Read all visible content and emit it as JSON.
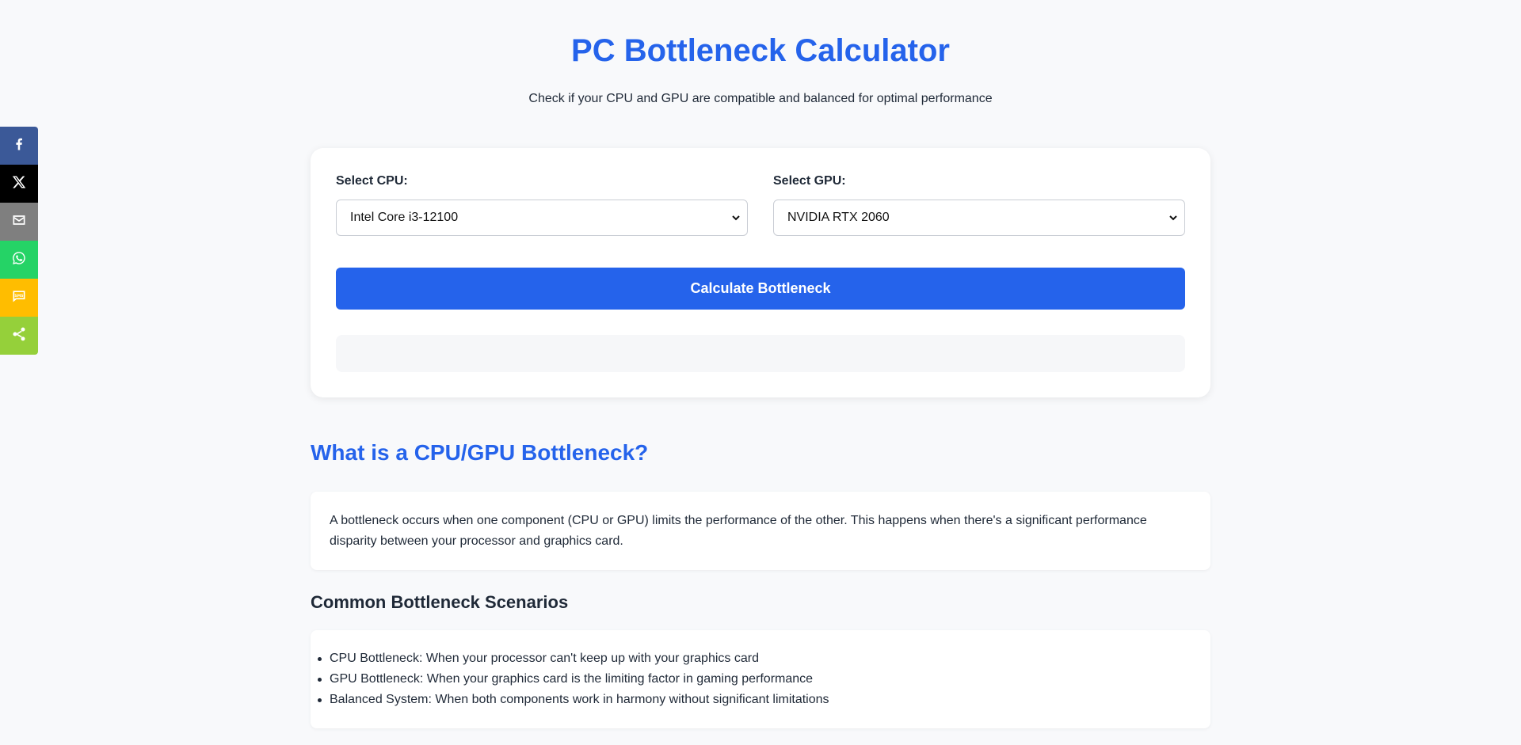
{
  "share": {
    "items": [
      {
        "name": "facebook",
        "color": "#3b5998",
        "icon": "facebook-icon"
      },
      {
        "name": "x",
        "color": "#000000",
        "icon": "x-icon"
      },
      {
        "name": "email",
        "color": "#7f7f7f",
        "icon": "email-icon"
      },
      {
        "name": "whatsapp",
        "color": "#25d366",
        "icon": "whatsapp-icon"
      },
      {
        "name": "sms",
        "color": "#ffbd00",
        "icon": "sms-icon"
      },
      {
        "name": "share",
        "color": "#95d03a",
        "icon": "share-icon"
      }
    ]
  },
  "header": {
    "title": "PC Bottleneck Calculator",
    "subtitle": "Check if your CPU and GPU are compatible and balanced for optimal performance"
  },
  "calculator": {
    "cpu_label": "Select CPU:",
    "cpu_value": "Intel Core i3-12100",
    "gpu_label": "Select GPU:",
    "gpu_value": "NVIDIA RTX 2060",
    "button_label": "Calculate Bottleneck",
    "accent_color": "#2563eb"
  },
  "content": {
    "section_title": "What is a CPU/GPU Bottleneck?",
    "section_text_line1": "A bottleneck occurs when one component (CPU or GPU) limits the performance of the other. This happens when there's a significant performance",
    "section_text_line2": "disparity between your processor and graphics card.",
    "scenarios_title": "Common Bottleneck Scenarios",
    "scenarios": [
      "CPU Bottleneck: When your processor can't keep up with your graphics card",
      "GPU Bottleneck: When your graphics card is the limiting factor in gaming performance",
      "Balanced System: When both components work in harmony without significant limitations"
    ]
  }
}
